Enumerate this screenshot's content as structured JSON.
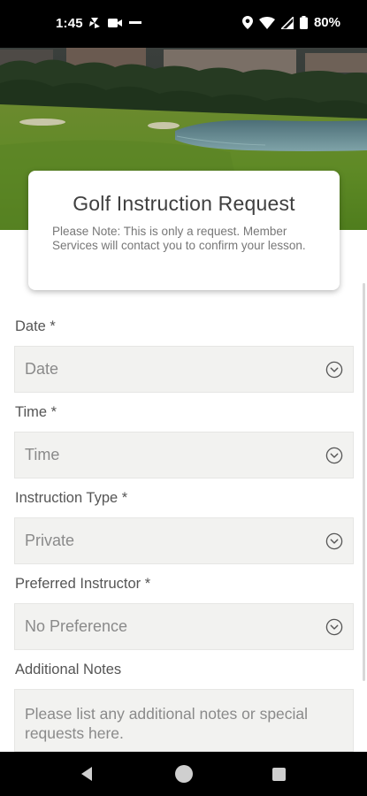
{
  "status_bar": {
    "time": "1:45",
    "battery": "80%"
  },
  "card": {
    "title": "Golf Instruction Request",
    "note": "Please Note: This is only a request. Member Services will contact you to confirm your lesson."
  },
  "form": {
    "date": {
      "label": "Date *",
      "value": "Date"
    },
    "time": {
      "label": "Time *",
      "value": "Time"
    },
    "instruction_type": {
      "label": "Instruction Type *",
      "value": "Private"
    },
    "preferred_instructor": {
      "label": "Preferred Instructor *",
      "value": "No Preference"
    },
    "additional_notes": {
      "label": "Additional Notes",
      "placeholder": "Please list any additional notes or special requests here."
    }
  },
  "icons": {
    "dropdown": "chevron-down-circle-icon",
    "status": [
      "fan-icon",
      "video-icon",
      "location-icon",
      "wifi-icon",
      "cellular-icon",
      "battery-icon"
    ],
    "nav": [
      "back-icon",
      "home-icon",
      "recents-icon"
    ]
  },
  "colors": {
    "field_background": "#f2f2f0",
    "system_bars": "#000000"
  }
}
